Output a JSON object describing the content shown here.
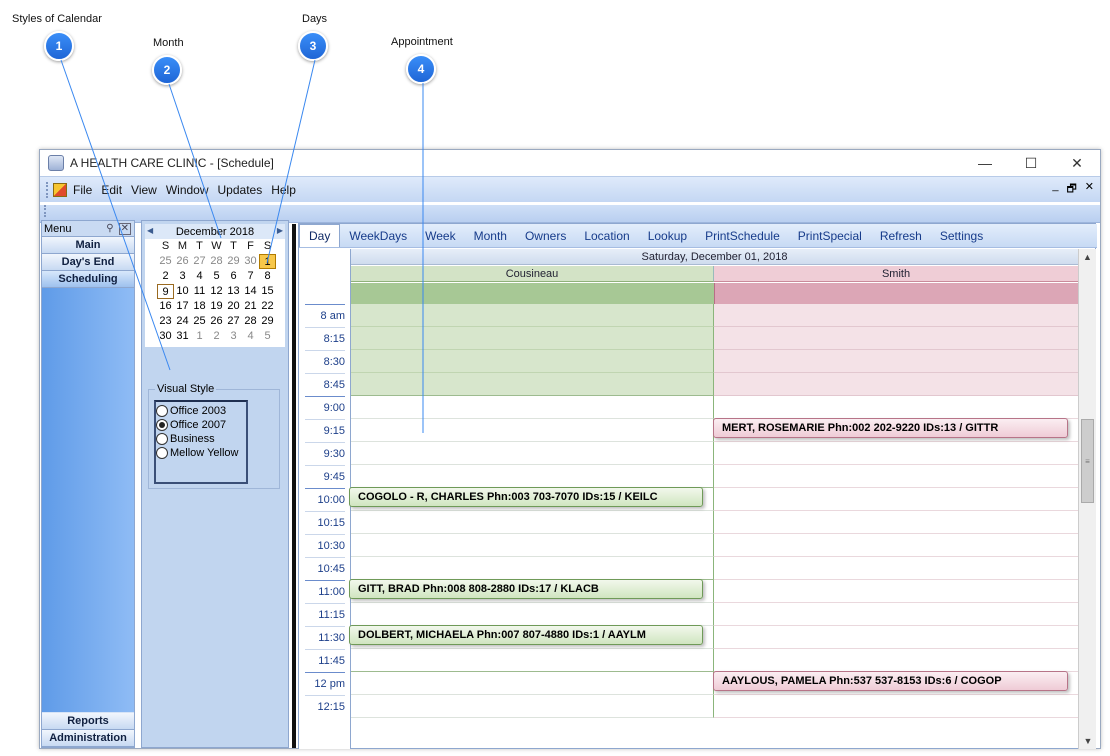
{
  "callouts": [
    {
      "num": "1",
      "label": "Styles of Calendar"
    },
    {
      "num": "2",
      "label": "Month"
    },
    {
      "num": "3",
      "label": "Days"
    },
    {
      "num": "4",
      "label": "Appointment"
    }
  ],
  "window": {
    "title": "A HEALTH CARE CLINIC - [Schedule]",
    "controls": {
      "minimize": "—",
      "maximize": "☐",
      "close": "✕"
    }
  },
  "menubar": {
    "items": [
      "File",
      "Edit",
      "View",
      "Window",
      "Updates",
      "Help"
    ],
    "mdi": {
      "minimize": "_",
      "restore": "🗗",
      "close": "✕"
    }
  },
  "nav": {
    "header": "Menu",
    "top_items": [
      "Main",
      "Day's End",
      "Scheduling"
    ],
    "bottom_items": [
      "Reports",
      "Administration"
    ]
  },
  "minical": {
    "month": "December 2018",
    "dow": [
      "S",
      "M",
      "T",
      "W",
      "T",
      "F",
      "S"
    ],
    "weeks": [
      [
        "25",
        "26",
        "27",
        "28",
        "29",
        "30",
        "1"
      ],
      [
        "2",
        "3",
        "4",
        "5",
        "6",
        "7",
        "8"
      ],
      [
        "9",
        "10",
        "11",
        "12",
        "13",
        "14",
        "15"
      ],
      [
        "16",
        "17",
        "18",
        "19",
        "20",
        "21",
        "22"
      ],
      [
        "23",
        "24",
        "25",
        "26",
        "27",
        "28",
        "29"
      ],
      [
        "30",
        "31",
        "1",
        "2",
        "3",
        "4",
        "5"
      ]
    ]
  },
  "visual_style": {
    "title": "Visual Style",
    "options": [
      "Office 2003",
      "Office 2007",
      "Business",
      "Mellow Yellow"
    ],
    "selected": "Office 2007"
  },
  "tabs": [
    "Day",
    "WeekDays",
    "Week",
    "Month",
    "Owners",
    "Location",
    "Lookup",
    "PrintSchedule",
    "PrintSpecial",
    "Refresh",
    "Settings"
  ],
  "active_tab": "Day",
  "schedule": {
    "date": "Saturday, December 01, 2018",
    "resources": [
      "Cousineau",
      "Smith"
    ],
    "times": [
      "8 am",
      "8:15",
      "8:30",
      "8:45",
      "9:00",
      "9:15",
      "9:30",
      "9:45",
      "10:00",
      "10:15",
      "10:30",
      "10:45",
      "11:00",
      "11:15",
      "11:30",
      "11:45",
      "12 pm",
      "12:15"
    ],
    "appointments": [
      {
        "resource": "Smith",
        "slot": 5,
        "text": "MERT, ROSEMARIE Phn:002 202-9220  IDs:13 / GITTR"
      },
      {
        "resource": "Cousineau",
        "slot": 8,
        "text": "COGOLO - R, CHARLES Phn:003 703-7070  IDs:15 / KEILC"
      },
      {
        "resource": "Cousineau",
        "slot": 12,
        "text": "GITT, BRAD Phn:008 808-2880  IDs:17 / KLACB"
      },
      {
        "resource": "Cousineau",
        "slot": 14,
        "text": "DOLBERT, MICHAELA Phn:007 807-4880  IDs:1 / AAYLM"
      },
      {
        "resource": "Smith",
        "slot": 16,
        "text": "AAYLOUS, PAMELA Phn:537 537-8153  IDs:6 / COGOP"
      }
    ]
  },
  "colors": {
    "cousineau_off": "#d7e6cc",
    "smith_off": "#f4e2e7",
    "cousineau_allday": "#a7c895",
    "smith_allday": "#dca6b6",
    "callout": "#2a78ee"
  }
}
